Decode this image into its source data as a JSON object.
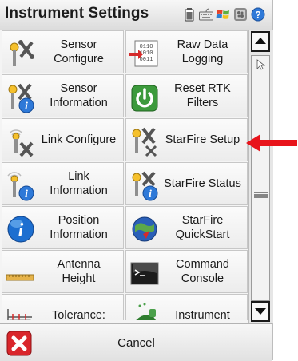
{
  "window": {
    "title": "Instrument Settings"
  },
  "tray_icons": [
    "battery-icon",
    "keyboard-icon",
    "windows-flag-icon",
    "settings-icon",
    "help-icon"
  ],
  "tiles": [
    {
      "label": "Sensor\nConfigure",
      "icon": "sensor-configure-icon"
    },
    {
      "label": "Raw Data\nLogging",
      "icon": "raw-data-logging-icon"
    },
    {
      "label": "Sensor\nInformation",
      "icon": "sensor-information-icon"
    },
    {
      "label": "Reset RTK\nFilters",
      "icon": "power-reset-icon"
    },
    {
      "label": "Link Configure",
      "icon": "link-configure-icon"
    },
    {
      "label": "StarFire Setup",
      "icon": "starfire-setup-icon"
    },
    {
      "label": "Link\nInformation",
      "icon": "link-information-icon"
    },
    {
      "label": "StarFire Status",
      "icon": "starfire-status-icon"
    },
    {
      "label": "Position\nInformation",
      "icon": "position-information-icon"
    },
    {
      "label": "StarFire\nQuickStart",
      "icon": "starfire-quickstart-icon"
    },
    {
      "label": "Antenna\nHeight",
      "icon": "antenna-height-icon"
    },
    {
      "label": "Command\nConsole",
      "icon": "command-console-icon"
    },
    {
      "label": "Tolerance:",
      "icon": "tolerance-icon"
    },
    {
      "label": "Instrument",
      "icon": "instrument-icon"
    }
  ],
  "cancel": {
    "label": "Cancel"
  },
  "colors": {
    "arrow": "#e8141b",
    "cancel_red": "#d9262b",
    "power_green": "#3c9a3c",
    "info_blue": "#1d6fd0"
  }
}
